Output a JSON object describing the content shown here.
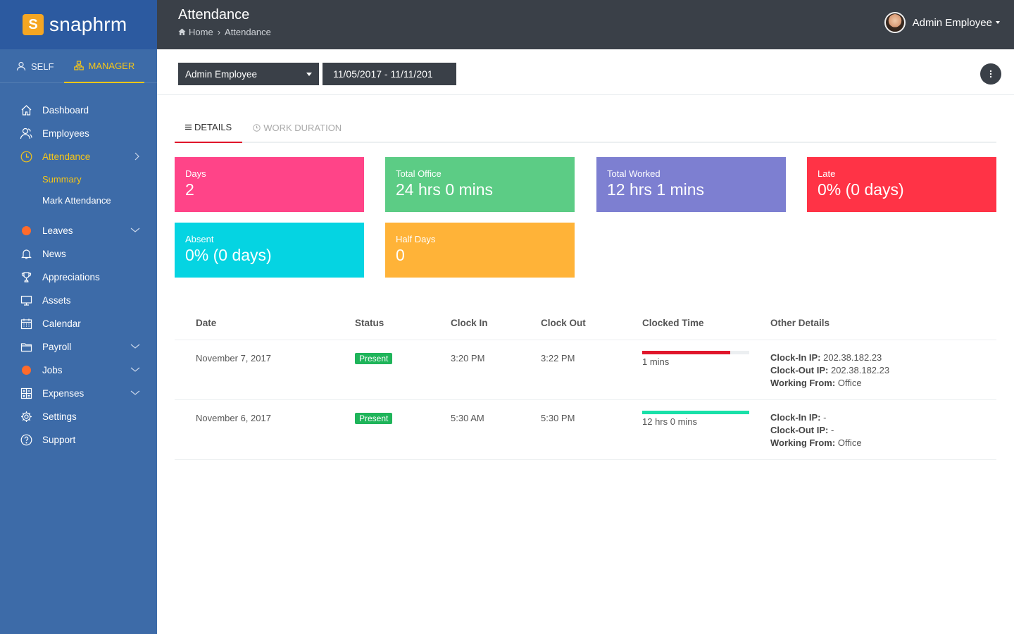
{
  "app": {
    "logo_letter": "S",
    "logo_text": "snaphrm"
  },
  "role_tabs": [
    {
      "label": "SELF",
      "icon": "user-icon",
      "active": false
    },
    {
      "label": "MANAGER",
      "icon": "sitemap-icon",
      "active": true
    }
  ],
  "sidebar": {
    "items": [
      {
        "label": "Dashboard",
        "icon": "home-icon"
      },
      {
        "label": "Employees",
        "icon": "users-icon"
      },
      {
        "label": "Attendance",
        "icon": "clock-icon",
        "active": true,
        "expanded": true
      },
      {
        "label": "Summary",
        "active": true
      },
      {
        "label": "Mark Attendance"
      },
      {
        "label": "Leaves",
        "icon": "dot-icon"
      },
      {
        "label": "News",
        "icon": "bell-icon"
      },
      {
        "label": "Appreciations",
        "icon": "trophy-icon"
      },
      {
        "label": "Assets",
        "icon": "monitor-icon"
      },
      {
        "label": "Calendar",
        "icon": "calendar-icon"
      },
      {
        "label": "Payroll",
        "icon": "folder-icon"
      },
      {
        "label": "Jobs",
        "icon": "dot-icon"
      },
      {
        "label": "Expenses",
        "icon": "calculator-icon"
      },
      {
        "label": "Settings",
        "icon": "gear-icon"
      },
      {
        "label": "Support",
        "icon": "help-icon"
      }
    ]
  },
  "header": {
    "title": "Attendance",
    "breadcrumb": [
      "Home",
      "Attendance"
    ],
    "user_name": "Admin Employee"
  },
  "filters": {
    "employee": "Admin Employee",
    "date_range": "11/05/2017 - 11/11/201"
  },
  "tabs": [
    {
      "label": "DETAILS",
      "icon": "list-icon",
      "active": true
    },
    {
      "label": "WORK DURATION",
      "icon": "clock-icon",
      "active": false
    }
  ],
  "stats": [
    {
      "label": "Days",
      "value": "2",
      "color": "#ff4488"
    },
    {
      "label": "Total Office",
      "value": "24 hrs 0 mins",
      "color": "#5ccc85"
    },
    {
      "label": "Total Worked",
      "value": "12 hrs 1 mins",
      "color": "#7d7fd1"
    },
    {
      "label": "Late",
      "value": "0% (0 days)",
      "color": "#ff3346"
    },
    {
      "label": "Absent",
      "value": "0% (0 days)",
      "color": "#05d4e2"
    },
    {
      "label": "Half Days",
      "value": "0",
      "color": "#ffb338"
    }
  ],
  "table": {
    "columns": [
      "Date",
      "Status",
      "Clock In",
      "Clock Out",
      "Clocked Time",
      "Other Details"
    ],
    "rows": [
      {
        "date": "November 7, 2017",
        "status": "Present",
        "clock_in": "3:20 PM",
        "clock_out": "3:22 PM",
        "clocked_time": "1 mins",
        "clocked_fraction": 0.82,
        "bar_color": "#e0162b",
        "clock_in_ip_label": "Clock-In IP:",
        "clock_in_ip": "202.38.182.23",
        "clock_out_ip_label": "Clock-Out IP:",
        "clock_out_ip": "202.38.182.23",
        "working_from_label": "Working From:",
        "working_from": "Office"
      },
      {
        "date": "November 6, 2017",
        "status": "Present",
        "clock_in": "5:30 AM",
        "clock_out": "5:30 PM",
        "clocked_time": "12 hrs 0 mins",
        "clocked_fraction": 1.0,
        "bar_color": "#19e0a8",
        "clock_in_ip_label": "Clock-In IP:",
        "clock_in_ip": "-",
        "clock_out_ip_label": "Clock-Out IP:",
        "clock_out_ip": "-",
        "working_from_label": "Working From:",
        "working_from": "Office"
      }
    ]
  }
}
